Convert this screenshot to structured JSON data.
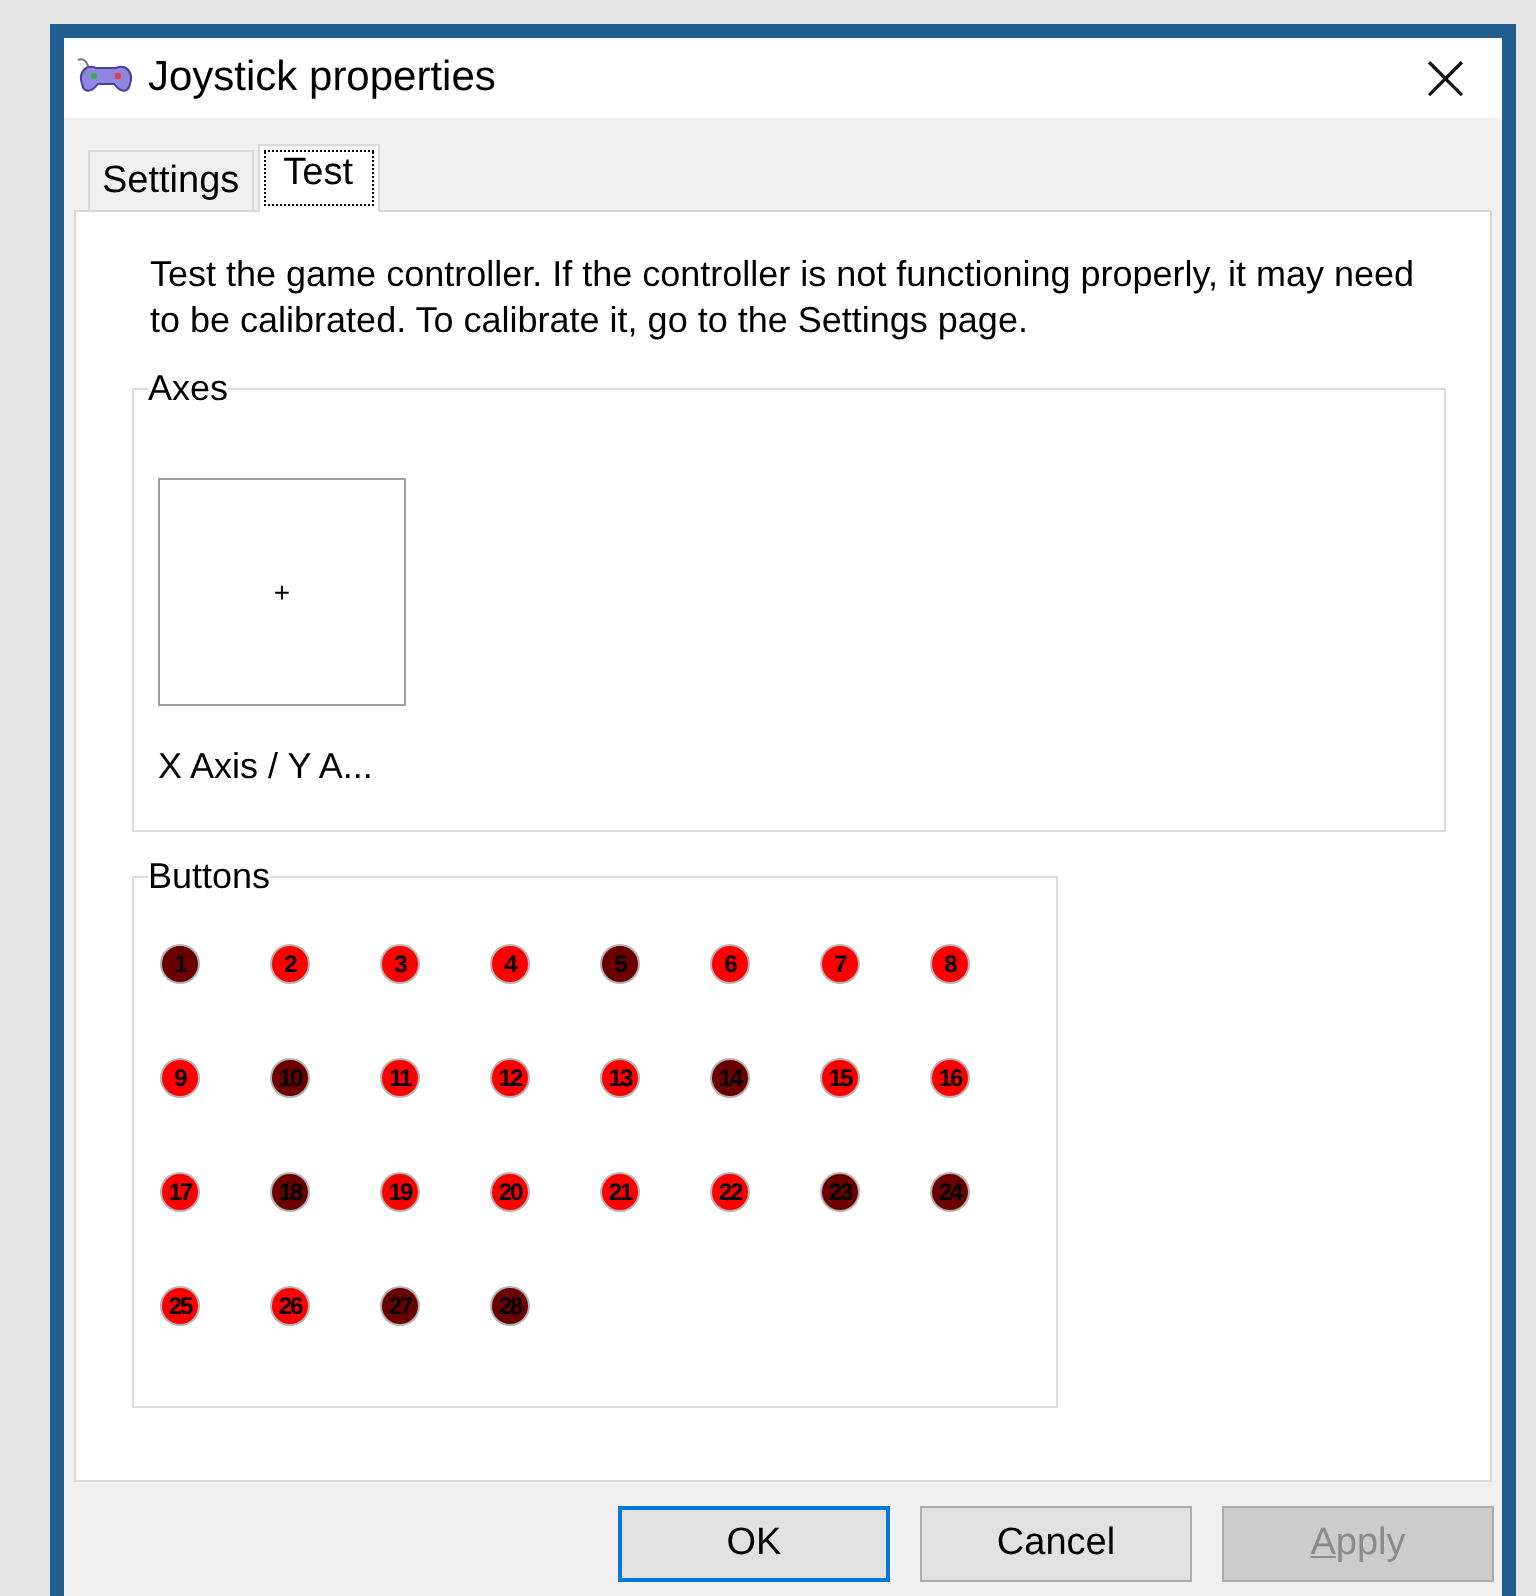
{
  "window": {
    "title": "Joystick properties",
    "close": "×"
  },
  "tabs": [
    {
      "label": "Settings",
      "selected": false
    },
    {
      "label": "Test",
      "selected": true
    }
  ],
  "intro": "Test the game controller.  If the controller is not functioning properly, it may need to be calibrated.  To calibrate it, go to the Settings page.",
  "axes": {
    "title": "Axes",
    "marker": "+",
    "label": "X Axis / Y A..."
  },
  "buttons_group": {
    "title": "Buttons",
    "items": [
      {
        "label": "1",
        "pressed": true
      },
      {
        "label": "2",
        "pressed": false
      },
      {
        "label": "3",
        "pressed": false
      },
      {
        "label": "4",
        "pressed": false
      },
      {
        "label": "5",
        "pressed": true
      },
      {
        "label": "6",
        "pressed": false
      },
      {
        "label": "7",
        "pressed": false
      },
      {
        "label": "8",
        "pressed": false
      },
      {
        "label": "9",
        "pressed": false
      },
      {
        "label": "10",
        "pressed": true
      },
      {
        "label": "11",
        "pressed": false
      },
      {
        "label": "12",
        "pressed": false
      },
      {
        "label": "13",
        "pressed": false
      },
      {
        "label": "14",
        "pressed": true
      },
      {
        "label": "15",
        "pressed": false
      },
      {
        "label": "16",
        "pressed": false
      },
      {
        "label": "17",
        "pressed": false
      },
      {
        "label": "18",
        "pressed": true
      },
      {
        "label": "19",
        "pressed": false
      },
      {
        "label": "20",
        "pressed": false
      },
      {
        "label": "21",
        "pressed": false
      },
      {
        "label": "22",
        "pressed": false
      },
      {
        "label": "23",
        "pressed": true
      },
      {
        "label": "24",
        "pressed": true
      },
      {
        "label": "25",
        "pressed": false
      },
      {
        "label": "26",
        "pressed": false
      },
      {
        "label": "27",
        "pressed": true
      },
      {
        "label": "28",
        "pressed": true
      }
    ]
  },
  "dialog_buttons": [
    {
      "label": "OK",
      "default": true,
      "disabled": false
    },
    {
      "label": "Cancel",
      "default": false,
      "disabled": false
    },
    {
      "label": "Apply",
      "default": false,
      "disabled": true
    }
  ]
}
